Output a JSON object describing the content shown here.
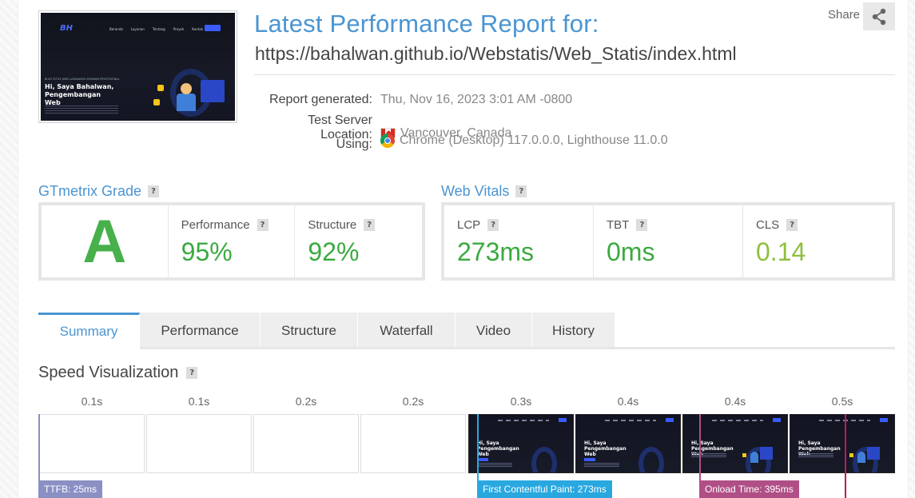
{
  "header": {
    "title": "Latest Performance Report for:",
    "url": "https://bahalwan.github.io/Webstatis/Web_Statis/index.html",
    "share_label": "Share"
  },
  "thumbnail": {
    "logo": "BH",
    "nav": [
      "Beranda",
      "Layanan",
      "Tentang",
      "Proyek",
      "Kontak"
    ],
    "small_text": "BUAT SITUS WEB LAYANANYA SEMAKIN PROFESIONAL",
    "heading_line1": "Hi, Saya Bahalwan,",
    "heading_line2": "Pengembangan",
    "heading_line3": "Web"
  },
  "meta": {
    "report_generated_label": "Report generated:",
    "report_generated_value": "Thu, Nov 16, 2023 3:01 AM -0800",
    "location_label": "Test Server Location:",
    "location_value": "Vancouver, Canada",
    "using_label": "Using:",
    "using_value": "Chrome (Desktop) 117.0.0.0, Lighthouse 11.0.0"
  },
  "grade": {
    "title": "GTmetrix Grade",
    "letter": "A",
    "performance_label": "Performance",
    "performance_value": "95%",
    "structure_label": "Structure",
    "structure_value": "92%"
  },
  "vitals": {
    "title": "Web Vitals",
    "lcp_label": "LCP",
    "lcp_value": "273ms",
    "tbt_label": "TBT",
    "tbt_value": "0ms",
    "cls_label": "CLS",
    "cls_value": "0.14"
  },
  "tabs": [
    "Summary",
    "Performance",
    "Structure",
    "Waterfall",
    "Video",
    "History"
  ],
  "speed": {
    "title": "Speed Visualization",
    "frames": [
      "0.1s",
      "0.1s",
      "0.2s",
      "0.2s",
      "0.3s",
      "0.4s",
      "0.4s",
      "0.5s"
    ],
    "mini_heading": "Hi, Saya",
    "mini_heading2": "Pengembangan",
    "mini_heading3": "Web",
    "markers": {
      "ttfb": "TTFB: 25ms",
      "fcp": "First Contentful Paint: 273ms",
      "onload": "Onload Time: 395ms"
    }
  },
  "colors": {
    "accent": "#4a95d2",
    "grade_green": "#47b04a",
    "ttfb": "#8a90c4",
    "fcp": "#29a8e0",
    "onload": "#b04f86",
    "lcp_line": "#c2185b"
  },
  "icons": {
    "share": "share-icon",
    "help": "help-icon",
    "flag": "canada-flag-icon",
    "browser": "chrome-icon"
  }
}
